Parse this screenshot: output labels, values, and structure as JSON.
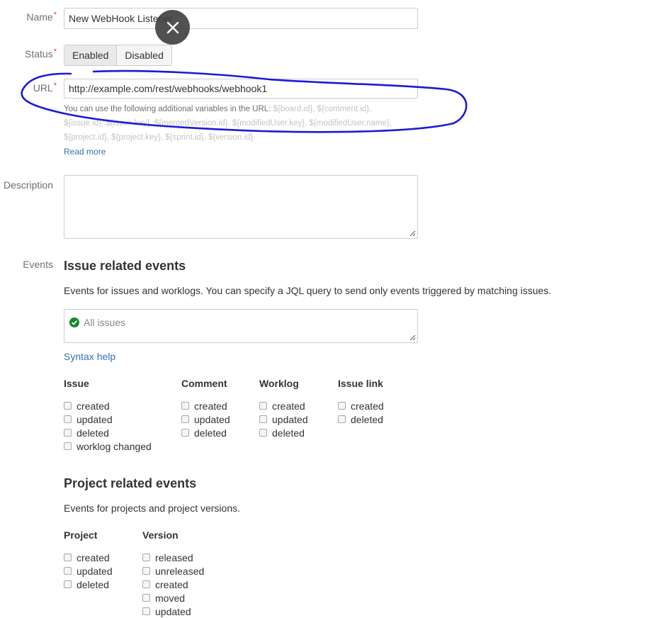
{
  "form": {
    "name": {
      "label": "Name",
      "required": "*",
      "value": "New WebHook Listener"
    },
    "status": {
      "label": "Status",
      "required": "*",
      "options": [
        "Enabled",
        "Disabled"
      ],
      "selected": "Enabled"
    },
    "url": {
      "label": "URL",
      "required": "*",
      "value": "http://example.com/rest/webhooks/webhook1",
      "help_prefix": "You can use the following additional variables in the URL:",
      "help_vars_1": "${board.id}, ${comment.id},",
      "help_vars_2": "${issue.id}, ${issue.key}, ${mergedVersion.id}, ${modifiedUser.key}, ${modifiedUser.name},",
      "help_vars_3": "${project.id}, ${project.key}, ${sprint.id}, ${version.id}",
      "read_more": "Read more"
    },
    "description": {
      "label": "Description",
      "value": ""
    },
    "events_label": "Events"
  },
  "issue_events": {
    "heading": "Issue related events",
    "description": "Events for issues and worklogs. You can specify a JQL query to send only events triggered by matching issues.",
    "jql_placeholder": "All issues",
    "syntax_help": "Syntax help",
    "columns": [
      {
        "title": "Issue",
        "items": [
          "created",
          "updated",
          "deleted",
          "worklog changed"
        ]
      },
      {
        "title": "Comment",
        "items": [
          "created",
          "updated",
          "deleted"
        ]
      },
      {
        "title": "Worklog",
        "items": [
          "created",
          "updated",
          "deleted"
        ]
      },
      {
        "title": "Issue link",
        "items": [
          "created",
          "deleted"
        ]
      }
    ]
  },
  "project_events": {
    "heading": "Project related events",
    "description": "Events for projects and project versions.",
    "columns": [
      {
        "title": "Project",
        "items": [
          "created",
          "updated",
          "deleted"
        ]
      },
      {
        "title": "Version",
        "items": [
          "released",
          "unreleased",
          "created",
          "moved",
          "updated"
        ]
      }
    ]
  },
  "colors": {
    "link": "#3572b0",
    "required": "#d04437",
    "annotation": "#1a1adb",
    "success": "#14892c"
  }
}
